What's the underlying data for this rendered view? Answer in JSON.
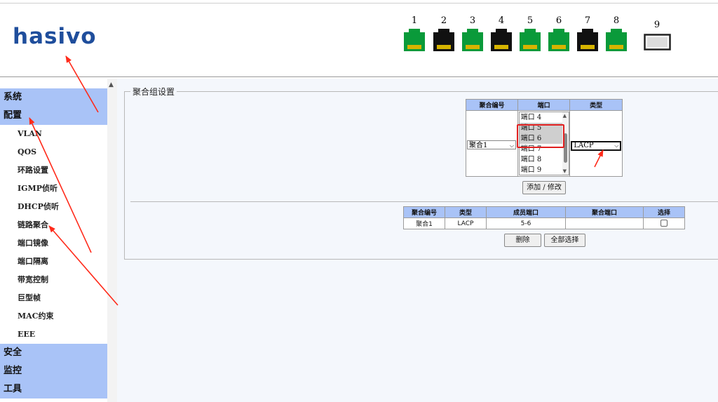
{
  "brand": {
    "logo_text": "hasivo",
    "logo_color": "#1f4e9c"
  },
  "ports": [
    {
      "label": "1",
      "type": "rj45",
      "status": "up",
      "color": "#0a9a3a"
    },
    {
      "label": "2",
      "type": "rj45",
      "status": "down",
      "color": "#111111"
    },
    {
      "label": "3",
      "type": "rj45",
      "status": "up",
      "color": "#0a9a3a"
    },
    {
      "label": "4",
      "type": "rj45",
      "status": "down",
      "color": "#111111"
    },
    {
      "label": "5",
      "type": "rj45",
      "status": "up",
      "color": "#0a9a3a"
    },
    {
      "label": "6",
      "type": "rj45",
      "status": "up",
      "color": "#0a9a3a"
    },
    {
      "label": "7",
      "type": "rj45",
      "status": "down",
      "color": "#111111"
    },
    {
      "label": "8",
      "type": "rj45",
      "status": "up",
      "color": "#0a9a3a"
    },
    {
      "label": "9",
      "type": "sfp",
      "status": "empty",
      "color": "#dddddd"
    }
  ],
  "sidebar": {
    "groups": [
      {
        "label": "系统",
        "items": []
      },
      {
        "label": "配置",
        "items": [
          "VLAN",
          "QOS",
          "环路设置",
          "IGMP侦听",
          "DHCP侦听",
          "链路聚合",
          "端口镜像",
          "端口隔离",
          "带宽控制",
          "巨型帧",
          "MAC约束",
          "EEE"
        ]
      },
      {
        "label": "安全",
        "items": []
      },
      {
        "label": "监控",
        "items": []
      },
      {
        "label": "工具",
        "items": []
      }
    ],
    "group_bg_color": "#a9c3f7"
  },
  "aggregation_settings": {
    "legend": "聚合组设置",
    "headers": {
      "group_id": "聚合编号",
      "port": "端口",
      "type": "类型"
    },
    "group_select_value": "聚合1",
    "port_list": [
      "端口 4",
      "端口 5",
      "端口 6",
      "端口 7",
      "端口 8",
      "端口 9"
    ],
    "selected_ports": [
      "端口 5",
      "端口 6"
    ],
    "type_select_value": "LACP",
    "add_button": "添加 / 修改"
  },
  "aggregation_table": {
    "headers": [
      "聚合编号",
      "类型",
      "成员端口",
      "聚合端口",
      "选择"
    ],
    "rows": [
      {
        "group_id": "聚合1",
        "type": "LACP",
        "members": "5-6",
        "agg_port": ""
      }
    ],
    "delete_button": "删除",
    "select_all_button": "全部选择"
  },
  "annotation_color": "#ff2a1a"
}
